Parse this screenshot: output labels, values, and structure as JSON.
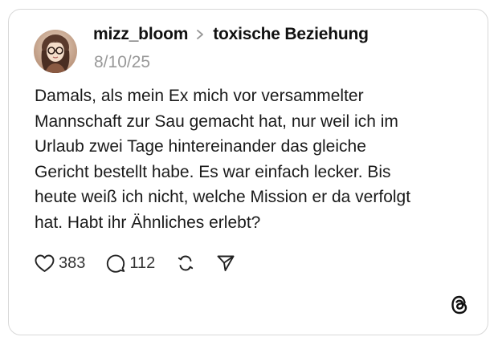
{
  "post": {
    "username": "mizz_bloom",
    "community": "toxische Beziehung",
    "date": "8/10/25",
    "text": "Damals, als mein Ex mich vor versammelter\nMannschaft zur Sau gemacht hat, nur weil ich im\nUrlaub zwei Tage hintereinander das gleiche\nGericht bestellt habe. Es war einfach lecker. Bis\nheute weiß ich nicht, welche Mission er da verfolgt\nhat. Habt ihr Ähnliches erlebt?"
  },
  "actions": {
    "likes": "383",
    "replies": "112"
  },
  "icons": {
    "like": "heart-icon",
    "reply": "comment-bubble-icon",
    "repost": "repost-icon",
    "share": "send-icon",
    "separator": "chevron-right-icon",
    "brand": "threads-logo-icon"
  },
  "colors": {
    "text": "#1a1a1a",
    "muted": "#999999",
    "border": "#d8d8d8"
  }
}
